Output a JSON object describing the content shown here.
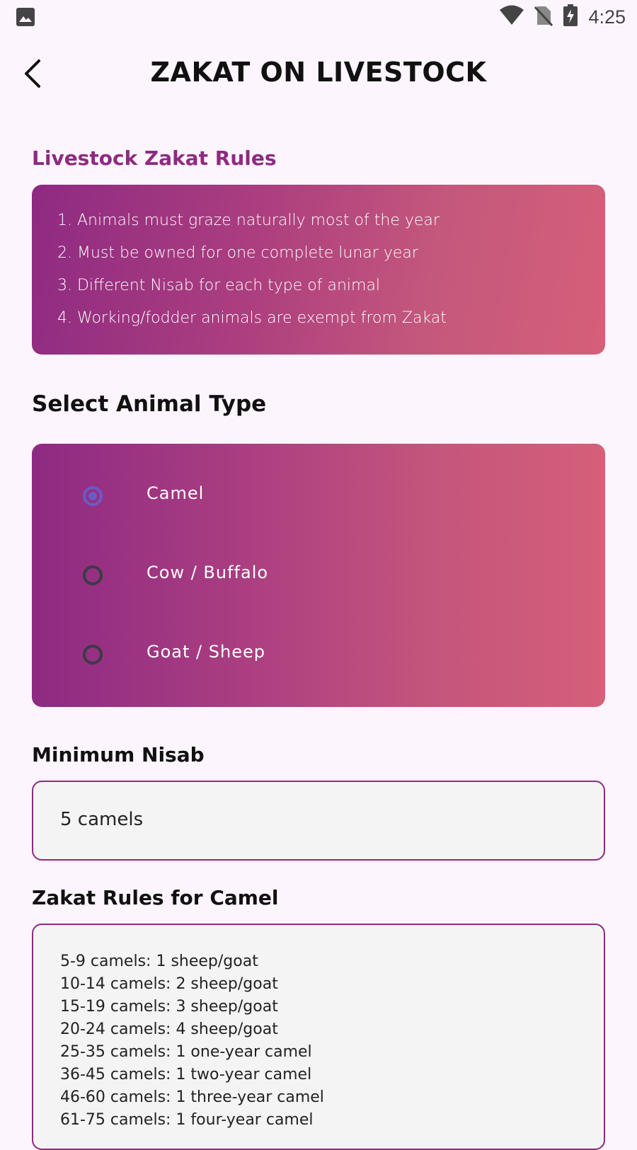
{
  "status_bar": {
    "time": "4:25",
    "icons": [
      "image-icon",
      "wifi-icon",
      "no-sim-icon",
      "battery-charging-icon"
    ]
  },
  "app_bar": {
    "title": "ZAKAT ON LIVESTOCK",
    "back_icon": "back-arrow-icon"
  },
  "rules_section": {
    "title": "Livestock Zakat Rules",
    "rules": [
      "1. Animals must graze naturally most of the year",
      "2. Must be owned for one complete lunar year",
      "3. Different Nisab for each type of animal",
      "4. Working/fodder animals are exempt from Zakat"
    ]
  },
  "animal_select": {
    "title": "Select Animal Type",
    "options": [
      {
        "label": "Camel",
        "selected": true
      },
      {
        "label": "Cow / Buffalo",
        "selected": false
      },
      {
        "label": "Goat / Sheep",
        "selected": false
      }
    ]
  },
  "nisab": {
    "title": "Minimum Nisab",
    "value": "5 camels"
  },
  "camel_rules": {
    "title": "Zakat Rules for Camel",
    "items": [
      "5-9 camels: 1 sheep/goat",
      "10-14 camels: 2 sheep/goat",
      "15-19 camels: 3 sheep/goat",
      "20-24 camels: 4 sheep/goat",
      "25-35 camels: 1 one-year camel",
      "36-45 camels: 1 two-year camel",
      "46-60 camels: 1 three-year camel",
      "61-75 camels: 1 four-year camel"
    ]
  },
  "colors": {
    "accent": "#8e2a82",
    "gradient_end": "#d65f79",
    "radio_selected": "#6a5ac6",
    "background": "#fdf5fd"
  }
}
